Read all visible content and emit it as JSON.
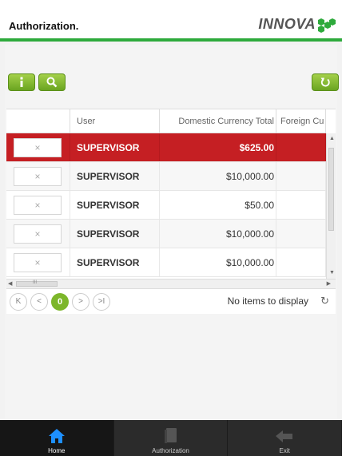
{
  "header": {
    "title": "Authorization.",
    "logo_text": "INNOVA"
  },
  "colors": {
    "accent": "#2eaa3c",
    "button": "#7cb62a",
    "selected_row": "#c51f23",
    "footer": "#2b2b2b"
  },
  "toolbar": {
    "info_icon": "info-icon",
    "search_icon": "search-icon",
    "refresh_icon": "refresh-icon"
  },
  "grid": {
    "columns": [
      "",
      "User",
      "Domestic Currency Total",
      "Foreign Cu"
    ],
    "rows": [
      {
        "action": "×",
        "user": "SUPERVISOR",
        "total": "$625.00",
        "selected": true
      },
      {
        "action": "×",
        "user": "SUPERVISOR",
        "total": "$10,000.00",
        "selected": false
      },
      {
        "action": "×",
        "user": "SUPERVISOR",
        "total": "$50.00",
        "selected": false
      },
      {
        "action": "×",
        "user": "SUPERVISOR",
        "total": "$10,000.00",
        "selected": false
      },
      {
        "action": "×",
        "user": "SUPERVISOR",
        "total": "$10,000.00",
        "selected": false
      }
    ],
    "scroll_thumb_label": "III"
  },
  "pager": {
    "first": "K",
    "prev": "<",
    "current_page": "0",
    "next": ">",
    "last": ">I",
    "info": "No items to display",
    "refresh": "↻"
  },
  "footer": {
    "items": [
      {
        "label": "Home",
        "icon": "home-icon",
        "active": true
      },
      {
        "label": "Authorization",
        "icon": "book-icon",
        "active": false
      },
      {
        "label": "Exit",
        "icon": "back-arrow-icon",
        "active": false
      }
    ]
  }
}
